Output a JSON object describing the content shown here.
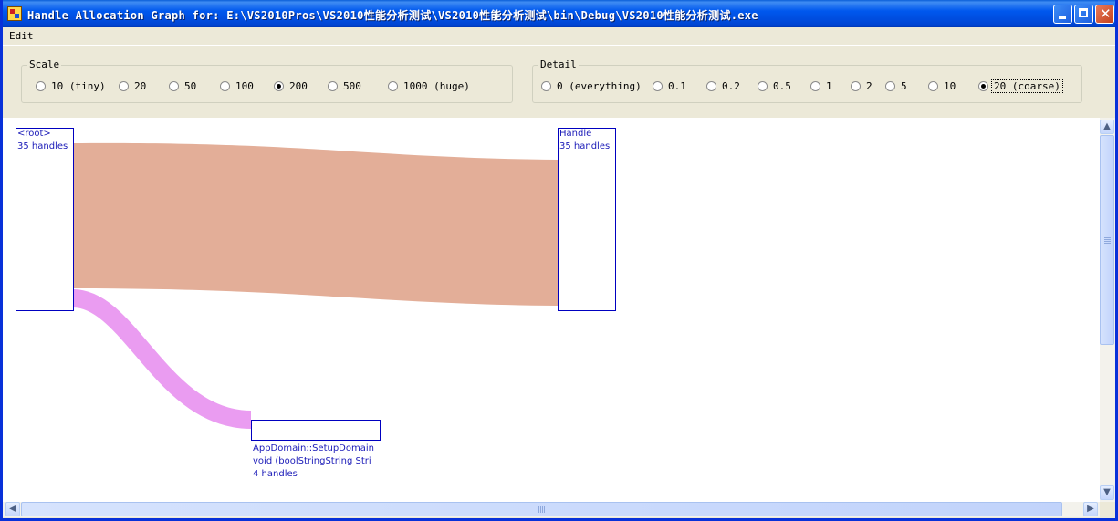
{
  "window": {
    "title": "Handle Allocation Graph for: E:\\VS2010Pros\\VS2010性能分析测试\\VS2010性能分析测试\\bin\\Debug\\VS2010性能分析测试.exe"
  },
  "menu": {
    "edit": "Edit"
  },
  "scale": {
    "legend": "Scale",
    "options": [
      "10 (tiny)",
      "20",
      "50",
      "100",
      "200",
      "500",
      "1000 (huge)"
    ],
    "selected": "200"
  },
  "detail": {
    "legend": "Detail",
    "options": [
      "0 (everything)",
      "0.1",
      "0.2",
      "0.5",
      "1",
      "2",
      "5",
      "10",
      "20 (coarse)"
    ],
    "selected": "20 (coarse)"
  },
  "graph": {
    "nodes": {
      "root": {
        "name": "<root>",
        "count": "35 handles"
      },
      "handle": {
        "name": "Handle",
        "count": "35 handles"
      },
      "appdomain": {
        "name": "AppDomain::SetupDomain",
        "signature": "void (boolStringString Stri",
        "count": "4 handles"
      }
    },
    "edges": [
      {
        "from": "<root>",
        "to": "Handle",
        "color": "#e3ae98"
      },
      {
        "from": "<root>",
        "to": "AppDomain::SetupDomain",
        "color": "#ea9cf1"
      }
    ]
  },
  "colors": {
    "titlebar": "#0058ee",
    "node_border": "#0000c0",
    "node_text": "#1a1ab8",
    "window_bg": "#ece9d8"
  }
}
